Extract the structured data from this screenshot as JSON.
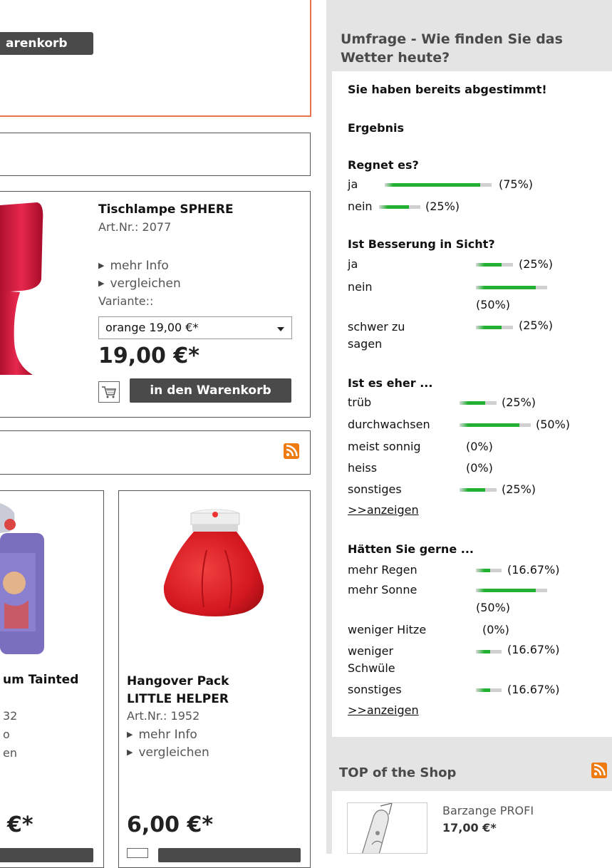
{
  "left": {
    "top_button_label": "arenkorb",
    "featured": {
      "title": "Tischlampe SPHERE",
      "artnr": "Art.Nr.: 2077",
      "more_info": "mehr Info",
      "compare": "vergleichen",
      "variant_label": "Variante::",
      "variant_selected": "orange 19,00 €*",
      "price": "19,00 €*",
      "cart_button": "in den Warenkorb"
    },
    "products": [
      {
        "title_line": "um Tainted",
        "artnr_fragment": "32",
        "info_fragment": "o",
        "compare_fragment": "en",
        "price_fragment": "€*"
      },
      {
        "title": "Hangover Pack LITTLE HELPER",
        "artnr": "Art.Nr.: 1952",
        "more_info": "mehr Info",
        "compare": "vergleichen",
        "price": "6,00 €*"
      }
    ]
  },
  "poll": {
    "title": "Umfrage - Wie finden Sie das Wetter heute?",
    "voted_msg": "Sie haben bereits abgestimmt!",
    "result_label": "Ergebnis",
    "questions": [
      {
        "question": "Regnet es?",
        "answers": [
          {
            "label": "ja",
            "percent": 75,
            "text": "(75%)"
          },
          {
            "label": "nein",
            "percent": 25,
            "text": "(25%)"
          }
        ]
      },
      {
        "question": "Ist Besserung in Sicht?",
        "answers": [
          {
            "label": "ja",
            "percent": 25,
            "text": "(25%)"
          },
          {
            "label": "nein",
            "percent": 50,
            "text": "(50%)"
          },
          {
            "label": "schwer zu sagen",
            "percent": 25,
            "text": "(25%)"
          }
        ]
      },
      {
        "question": "Ist es eher ...",
        "answers": [
          {
            "label": "trüb",
            "percent": 25,
            "text": "(25%)"
          },
          {
            "label": "durchwachsen",
            "percent": 50,
            "text": "(50%)"
          },
          {
            "label": "meist sonnig",
            "percent": 0,
            "text": "(0%)"
          },
          {
            "label": "heiss",
            "percent": 0,
            "text": "(0%)"
          },
          {
            "label": "sonstiges",
            "percent": 25,
            "text": "(25%)"
          }
        ],
        "link": ">>anzeigen"
      },
      {
        "question": "Hätten Sie gerne ...",
        "answers": [
          {
            "label": "mehr Regen",
            "percent": 16.67,
            "text": "(16.67%)"
          },
          {
            "label": "mehr Sonne",
            "percent": 50,
            "text": "(50%)"
          },
          {
            "label": "weniger Hitze",
            "percent": 0,
            "text": "(0%)"
          },
          {
            "label": "weniger Schwüle",
            "percent": 16.67,
            "text": "(16.67%)"
          },
          {
            "label": "sonstiges",
            "percent": 16.67,
            "text": "(16.67%)"
          }
        ],
        "link": ">>anzeigen"
      }
    ]
  },
  "top_shop": {
    "title": "TOP of the Shop",
    "item_name": "Barzange PROFI",
    "item_price": "17,00 €*"
  },
  "colors": {
    "bar_green": "#22b033",
    "button_dark": "#4a4a4a",
    "accent_orange": "#ee7a12",
    "featured_border": "#e8744a"
  }
}
